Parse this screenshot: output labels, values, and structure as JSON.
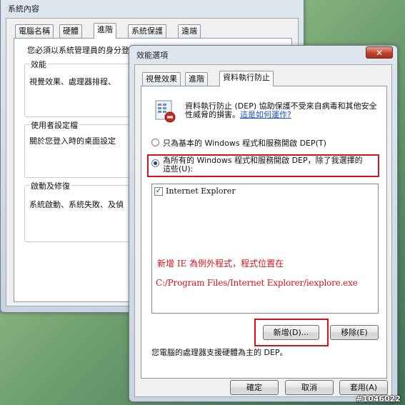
{
  "system_properties": {
    "title": "系統內容",
    "tabs": [
      "電腦名稱",
      "硬體",
      "進階",
      "系統保護",
      "遠端"
    ],
    "admin_notice": "您必須以系統管理員的身分登入",
    "groups": [
      {
        "title": "效能",
        "desc": "視覺效果、處理器排程、"
      },
      {
        "title": "使用者設定檔",
        "desc": "關於您登入時的桌面設定"
      },
      {
        "title": "啟動及修復",
        "desc": "系統啟動、系統失敗、及偵"
      }
    ]
  },
  "performance_options": {
    "title": "效能選項",
    "close_glyph": "✕",
    "tabs": [
      "視覺效果",
      "進階",
      "資料執行防止"
    ],
    "description": "資料執行防止 (DEP) 協助保護不受來自病毒和其他安全性威脅的損害。",
    "link": "這是如何運作?",
    "option1": "只為基本的 Windows 程式和服務開啟 DEP(T)",
    "option2_line1": "為所有的 Windows 程式和服務開啟 DEP，除了我選擇的",
    "option2_line2": "這些(U):",
    "program_list": [
      {
        "name": "Internet Explorer",
        "checked": true
      }
    ],
    "annotation_line1": "新增 IE 為例外程式，程式位置在",
    "annotation_line2": "C:/Program Files/Internet Explorer/iexplore.exe",
    "add_button": "新增(D)...",
    "remove_button": "移除(E)",
    "hardware_note": "您電腦的處理器支援硬體為主的 DEP。",
    "ok_button": "確定",
    "cancel_button": "取消",
    "apply_button": "套用(A)",
    "accent_red": "#d3141b",
    "link_color": "#1a4ec0"
  },
  "watermark": "#1046022",
  "icons": {
    "dep": "dep-shield-icon",
    "close": "close-icon",
    "check": "checkmark-icon"
  }
}
